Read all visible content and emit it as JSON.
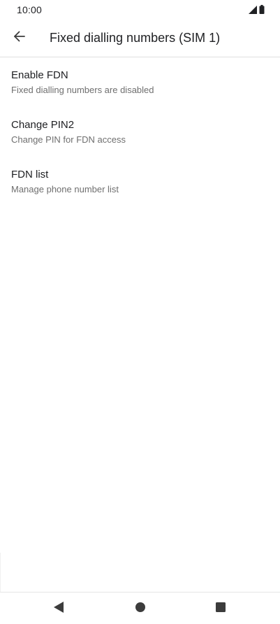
{
  "status_bar": {
    "time": "10:00",
    "icons": [
      "signal-icon",
      "battery-icon"
    ]
  },
  "app_bar": {
    "back_icon": "arrow-back-icon",
    "title": "Fixed dialling numbers (SIM 1)"
  },
  "settings": {
    "items": [
      {
        "title": "Enable FDN",
        "subtitle": "Fixed dialling numbers are disabled"
      },
      {
        "title": "Change PIN2",
        "subtitle": "Change PIN for FDN access"
      },
      {
        "title": "FDN list",
        "subtitle": "Manage phone number list"
      }
    ]
  },
  "nav_bar": {
    "buttons": [
      "nav-back-icon",
      "nav-home-icon",
      "nav-recents-icon"
    ]
  },
  "colors": {
    "text_primary": "#202124",
    "text_secondary": "#6f6f6f",
    "divider": "#e0e0e0",
    "nav_icon": "#3c3c3c"
  }
}
